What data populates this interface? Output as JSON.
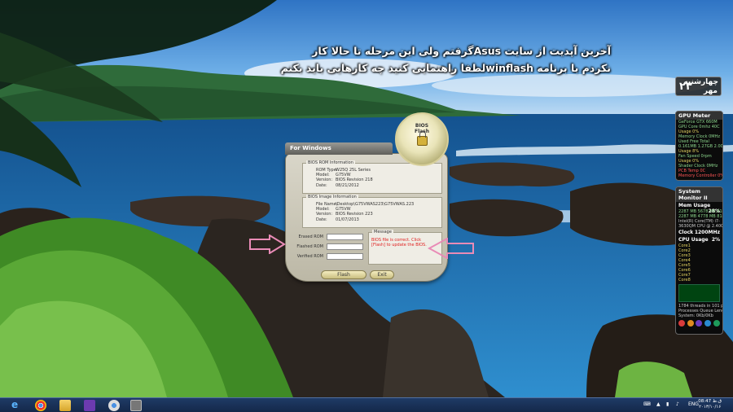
{
  "overlay_text": {
    "line1": "آخرین آپدیت از سایت Asusگرفتم ولی این مرحله تا حالا کار",
    "line2": "نکردم با برنامه winflashلطفا راهنمایی کنید چه کارهایی باید بکنم"
  },
  "date_gadget": {
    "day_number": "۲۳",
    "weekday": "چهارشنبه",
    "month": "مهر"
  },
  "gpu_meter": {
    "title": "GPU Meter",
    "rows": [
      "GeForce GTX 660M",
      "GPU Core 0mhz 40C",
      "Usage 0%",
      "Memory Clock 0MHz",
      "Used Free Total",
      "0.161MB 1.27GB 2.00GB",
      "Usage 8%",
      "Fan Speed 0rpm",
      "Usage 0%",
      "Shader Clock 0MHz",
      "PCB Temp 0C",
      "Memory Controller 0%"
    ]
  },
  "system_monitor": {
    "title": "System Monitor II",
    "mem_label": "Mem Usage",
    "mem_value": "28%",
    "rows": [
      "2287 MB  5678 MB  8143 MB",
      "2287 MB  4778 MB  8143 MB",
      "Intel(R) Core(TM) i7-",
      "3630QM CPU @ 2.40GHz"
    ],
    "clock_label": "Clock",
    "clock_value": "1200MHz",
    "cpu_label": "CPU Usage",
    "cpu_value": "2%",
    "cores": [
      "Core1",
      "Core2",
      "Core3",
      "Core4",
      "Core5",
      "Core6",
      "Core7",
      "Core8"
    ],
    "footer": [
      "1784 threads in 101 process",
      "Processes Queue Length: 0",
      "System: 0Kb/0Kb"
    ],
    "dot_colors": [
      "#d93b3b",
      "#e08a20",
      "#6a3bbf",
      "#2a8ad0",
      "#1e9a5a"
    ]
  },
  "winflash": {
    "header": "For Windows",
    "badge_line1": "BIOS",
    "badge_line2": "Flash",
    "rom_info_title": "BIOS ROM Information",
    "rom_info": [
      {
        "k": "ROM Type:",
        "v": "W25Q 25L Series"
      },
      {
        "k": "Model:",
        "v": "G75VW"
      },
      {
        "k": "Version:",
        "v": "BIOS Revision 218"
      },
      {
        "k": "Date:",
        "v": "08/21/2012"
      }
    ],
    "image_info_title": "BIOS Image Information",
    "image_info": [
      {
        "k": "File Name:",
        "v": "\\Desktop\\G75VWAS223\\G75VWAS.223"
      },
      {
        "k": "Model:",
        "v": "G75VW"
      },
      {
        "k": "Version:",
        "v": "BIOS Revision 223"
      },
      {
        "k": "Date:",
        "v": "01/07/2013"
      }
    ],
    "message_title": "Message",
    "message": "BIOS file is correct. Click [Flash] to update the BIOS.",
    "erased_label": "Erased ROM",
    "flashed_label": "Flashed ROM",
    "verified_label": "Verified ROM",
    "flash_button": "Flash",
    "exit_button": "Exit"
  },
  "taskbar": {
    "apps": [
      "ie-icon",
      "chrome-icon",
      "explorer-icon",
      "visual-studio-icon",
      "chrome-alt-icon",
      "winflash-taskbar-icon"
    ],
    "tray_lang": "ENG",
    "time": "08:47 ق.ظ",
    "date": "۲۰۱۳/۱۰/۱۶"
  }
}
